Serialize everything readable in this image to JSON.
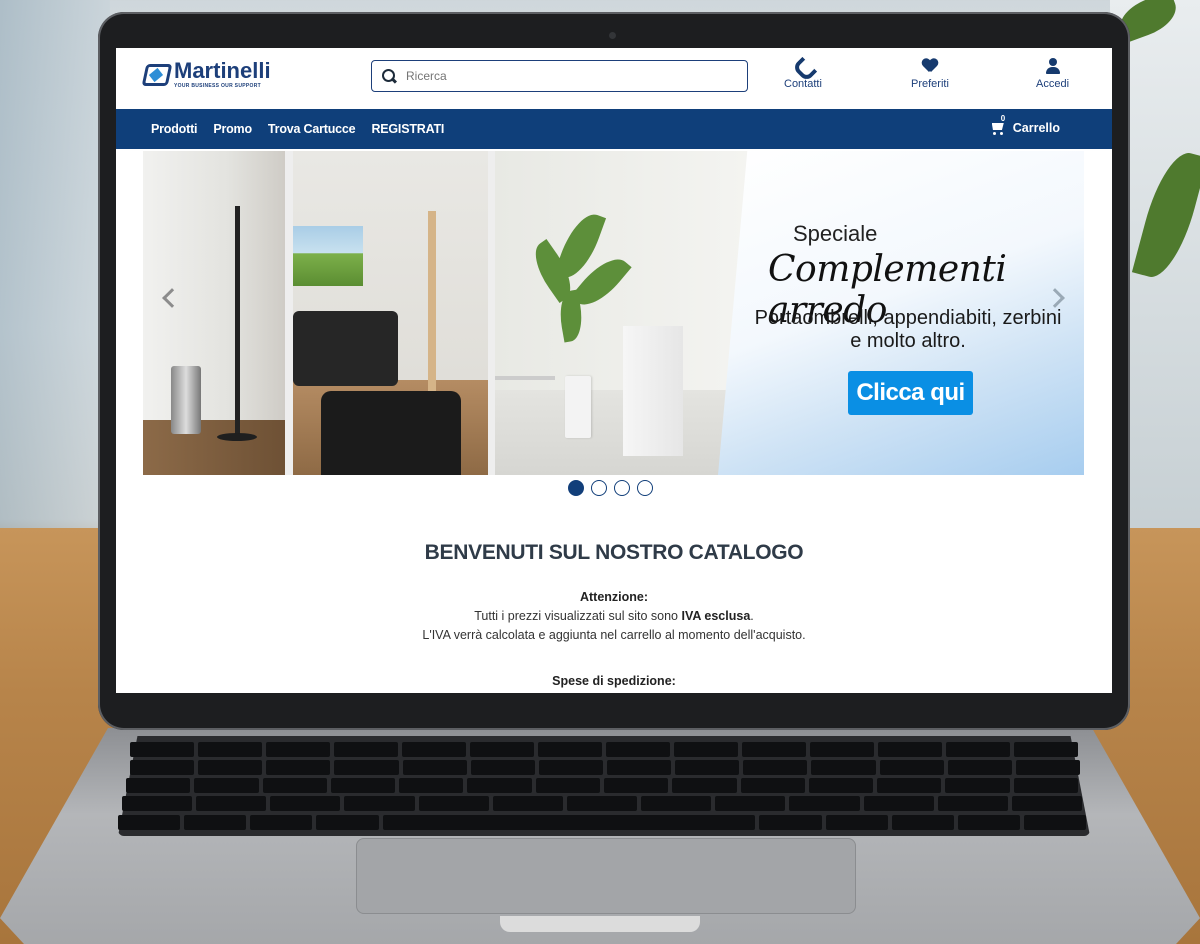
{
  "brand": {
    "name": "Martinelli",
    "tagline": "YOUR BUSINESS OUR SUPPORT"
  },
  "search": {
    "placeholder": "Ricerca"
  },
  "header_actions": {
    "contacts": "Contatti",
    "favorites": "Preferiti",
    "login": "Accedi"
  },
  "nav": {
    "items": [
      "Prodotti",
      "Promo",
      "Trova Cartucce",
      "REGISTRATI"
    ],
    "cart_label": "Carrello",
    "cart_count": "0"
  },
  "banner": {
    "kicker": "Speciale",
    "headline": "Complementi arredo",
    "description": "Portaombrelli, appendiabiti, zerbini e molto altro.",
    "cta": "Clicca qui",
    "slides_total": 4,
    "active_slide": 1
  },
  "content": {
    "welcome_title": "BENVENUTI SUL NOSTRO CATALOGO",
    "notice_title": "Attenzione:",
    "notice_line1_prefix": "Tutti i prezzi visualizzati sul sito sono ",
    "notice_line1_bold": "IVA esclusa",
    "notice_line1_suffix": ".",
    "notice_line2": "L'IVA verrà calcolata e aggiunta nel carrello al momento dell'acquisto.",
    "shipping_title": "Spese di spedizione:"
  },
  "colors": {
    "brand_blue": "#0f3f7a",
    "cta_blue": "#0a8fe4"
  },
  "icons": [
    "search-icon",
    "phone-icon",
    "heart-icon",
    "user-icon",
    "cart-icon",
    "chevron-left-icon",
    "chevron-right-icon"
  ]
}
